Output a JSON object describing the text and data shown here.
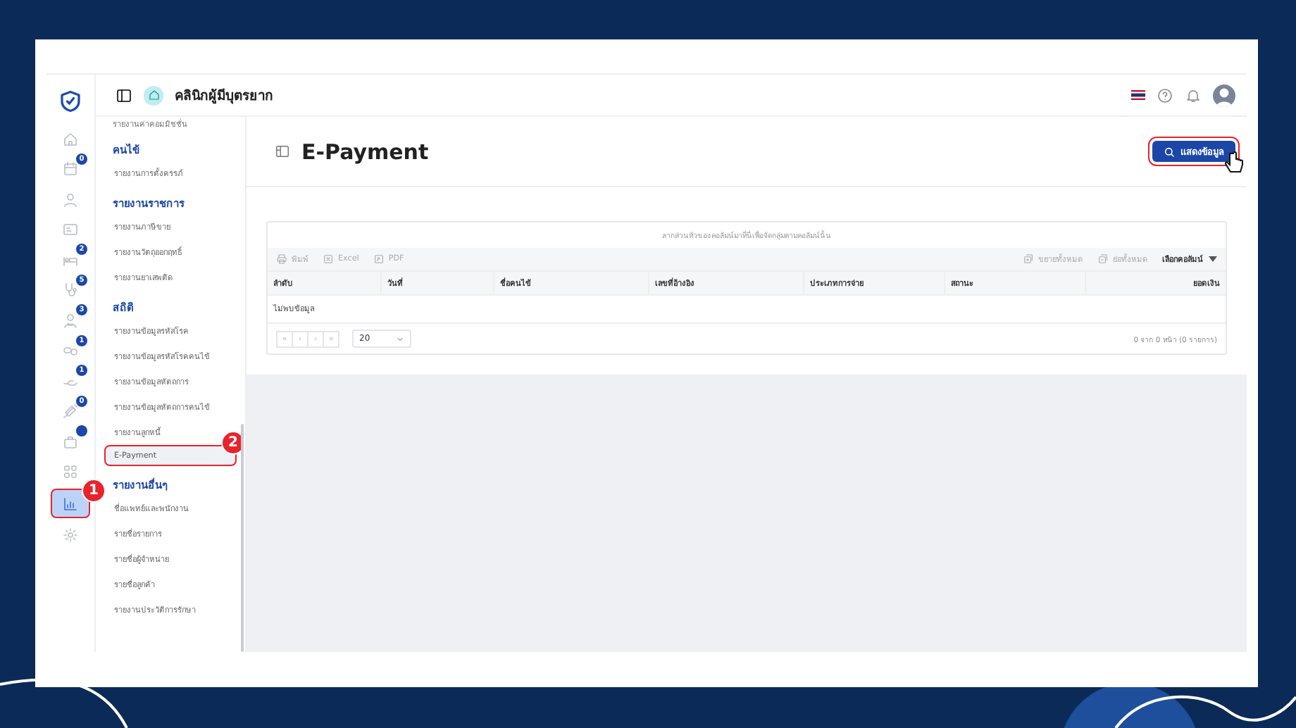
{
  "header": {
    "clinic_name": "คลินิกผู้มีบุตรยาก"
  },
  "rail": [
    {
      "dot": false,
      "selected": false
    },
    {
      "badge": "0",
      "dot": false,
      "selected": false
    },
    {
      "dot": false,
      "selected": false
    },
    {
      "dot": false,
      "selected": false
    },
    {
      "badge": "2",
      "dot": false,
      "selected": false
    },
    {
      "badge": "5",
      "dot": false,
      "selected": false
    },
    {
      "badge": "3",
      "dot": false,
      "selected": false
    },
    {
      "badge": "1",
      "dot": false,
      "selected": false
    },
    {
      "badge": "1",
      "dot": false,
      "selected": false
    },
    {
      "badge": "0",
      "dot": false,
      "selected": false
    },
    {
      "dot": true,
      "selected": false
    },
    {
      "dot": false,
      "selected": false
    },
    {
      "dot": false,
      "selected": true,
      "callout": "1"
    },
    {
      "dot": false,
      "selected": false
    }
  ],
  "menu": {
    "top_item": "รายงานค่าคอมมิชชั่น",
    "sections": [
      {
        "title": "คนไข้",
        "items": [
          {
            "label": "รายงานการตั้งครรภ์",
            "selected": false
          }
        ]
      },
      {
        "title": "รายงานราชการ",
        "items": [
          {
            "label": "รายงานภาษีขาย",
            "selected": false
          },
          {
            "label": "รายงานวัตถุออกฤทธิ์",
            "selected": false
          },
          {
            "label": "รายงานยาเสพติด",
            "selected": false
          }
        ]
      },
      {
        "title": "สถิติ",
        "items": [
          {
            "label": "รายงานข้อมูลรหัสโรค",
            "selected": false
          },
          {
            "label": "รายงานข้อมูลรหัสโรคคนไข้",
            "selected": false
          },
          {
            "label": "รายงานข้อมูลหัตถการ",
            "selected": false
          },
          {
            "label": "รายงานข้อมูลหัตถการคนไข้",
            "selected": false
          },
          {
            "label": "รายงานลูกหนี้",
            "selected": false
          },
          {
            "label": "E-Payment",
            "selected": true,
            "callout": "2"
          }
        ]
      },
      {
        "title": "รายงานอื่นๆ",
        "items": [
          {
            "label": "ชื่อแพทย์และพนักงาน",
            "selected": false
          },
          {
            "label": "รายชื่อรายการ",
            "selected": false
          },
          {
            "label": "รายชื่อผู้จำหน่าย",
            "selected": false
          },
          {
            "label": "รายชื่อลูกค้า",
            "selected": false
          },
          {
            "label": "รายงานประวัติการรักษา",
            "selected": false
          }
        ]
      }
    ]
  },
  "page": {
    "title": "E-Payment",
    "show_button": {
      "label": "แสดงข้อมูล",
      "highlighted": true
    }
  },
  "grid": {
    "group_hint": "ลากส่วนหัวของคอลัมน์มาที่นี่เพื่อจัดกลุ่มตามคอลัมน์นั้น",
    "toolbar_left": [
      {
        "kind": "print",
        "label": "พิมพ์"
      },
      {
        "kind": "excel",
        "label": "Excel"
      },
      {
        "kind": "pdf",
        "label": "PDF"
      }
    ],
    "toolbar_right": [
      {
        "kind": "expand",
        "label": "ขยายทั้งหมด"
      },
      {
        "kind": "collapse",
        "label": "ย่อทั้งหมด"
      }
    ],
    "column_chooser": "เลือกคอลัมน์",
    "columns": [
      "ลำดับ",
      "วันที่",
      "ชื่อคนไข้",
      "เลขที่อ้างอิง",
      "ประเภทการจ่าย",
      "สถานะ",
      "ยอดเงิน"
    ],
    "empty_text": "ไม่พบข้อมูล",
    "pager": {
      "buttons": [
        "«",
        "‹",
        "›",
        "»"
      ],
      "page_size": "20",
      "info": "0 จาก 0 หน้า (0 รายการ)"
    }
  }
}
